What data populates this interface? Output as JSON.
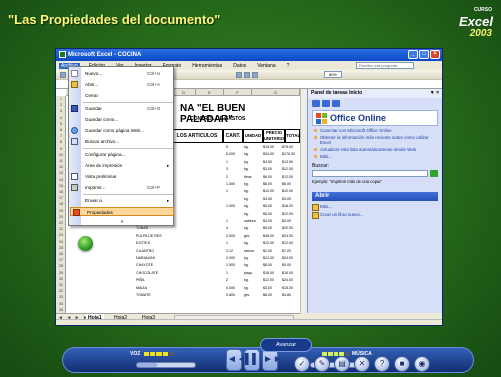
{
  "course": {
    "title": "\"Las Propiedades del documento\"",
    "logo_curso": "CURSO",
    "logo_excel": "Excel",
    "logo_year": "2003"
  },
  "window": {
    "title": "Microsoft Excel - COCINA",
    "btn_min": "_",
    "btn_max": "□",
    "btn_close": "×"
  },
  "menubar": {
    "items": [
      "Archivo",
      "Edición",
      "Ver",
      "Insertar",
      "Formato",
      "Herramientas",
      "Datos",
      "Ventana",
      "?"
    ],
    "help_placeholder": "Escriba una pregunta",
    "zoom": "80%"
  },
  "sheet": {
    "title": "NA \"EL BUEN PALADAR\"",
    "subtitle": "CONTROL DE GASTOS",
    "columns": [
      "A",
      "B",
      "C",
      "D",
      "E",
      "F",
      "G"
    ],
    "headers": {
      "articulos": "LOS ARTICULOS",
      "cant": "CANT.",
      "unidad": "UNIDAD",
      "precio": "PRECIO UNITARIO",
      "total": "TOTAL"
    },
    "row_numbers": [
      "1",
      "2",
      "3",
      "4",
      "5",
      "6",
      "7",
      "8",
      "9",
      "10",
      "11",
      "12",
      "13",
      "14",
      "15",
      "16",
      "17",
      "18",
      "19",
      "20",
      "21",
      "22",
      "23",
      "24",
      "25",
      "26",
      "27",
      "28",
      "29",
      "30",
      "31",
      "32",
      "33",
      "34",
      "35"
    ],
    "rows": [
      {
        "item": "",
        "cant": "5",
        "unidad": "kg.",
        "precio": "$15.00",
        "total": "$75.00"
      },
      {
        "item": "",
        "cant": "5.000",
        "unidad": "kg.",
        "precio": "$34.00",
        "total": "$170.00"
      },
      {
        "item": "",
        "cant": "1",
        "unidad": "kg.",
        "precio": "$4.50",
        "total": "$13.50"
      },
      {
        "item": "",
        "cant": "3",
        "unidad": "kg.",
        "precio": "$3.00",
        "total": "$12.00"
      },
      {
        "item": "",
        "cant": "2",
        "unidad": "litros",
        "precio": "$6.00",
        "total": "$12.00"
      },
      {
        "item": "",
        "cant": "1.000",
        "unidad": "kg.",
        "precio": "$6.00",
        "total": "$6.00"
      },
      {
        "item": "AMARRO",
        "cant": "1",
        "unidad": "kg.",
        "precio": "$10.00",
        "total": "$10.00"
      },
      {
        "item": "CEBOLLA",
        "cant": "",
        "unidad": "kg.",
        "precio": "$3.00",
        "total": "$3.00"
      },
      {
        "item": "ZANAHORIA",
        "cant": "1.000",
        "unidad": "kg.",
        "precio": "$5.00",
        "total": "$16.20"
      },
      {
        "item": "APIO/MATE",
        "cant": "",
        "unidad": "kg.",
        "precio": "$6.00",
        "total": "$12.00"
      },
      {
        "item": "AJOS",
        "cant": "1",
        "unidad": "cabeza",
        "precio": "$3.00",
        "total": "$3.00"
      },
      {
        "item": "TUNAS",
        "cant": "4",
        "unidad": "kg.",
        "precio": "$5.00",
        "total": "$20.00"
      },
      {
        "item": "PULPA DE RES",
        "cant": "0.500",
        "unidad": "grs.",
        "precio": "$48.00",
        "total": "$24.00"
      },
      {
        "item": "EJOTES",
        "cant": "1",
        "unidad": "kg.",
        "precio": "$12.00",
        "total": "$12.00"
      },
      {
        "item": "CILANTRO",
        "cant": "3.12",
        "unidad": "ramos",
        "precio": "$2.00",
        "total": "$7.20"
      },
      {
        "item": "NARANJAS",
        "cant": "2.000",
        "unidad": "kg.",
        "precio": "$12.00",
        "total": "$24.00"
      },
      {
        "item": "CHAYOTE",
        "cant": "1.500",
        "unidad": "kg.",
        "precio": "$6.00",
        "total": "$9.00"
      },
      {
        "item": "CHOCOLATE",
        "cant": "1",
        "unidad": "paqu.",
        "precio": "$16.00",
        "total": "$16.00"
      },
      {
        "item": "PIÑA",
        "cant": "2",
        "unidad": "kg.",
        "precio": "$12.00",
        "total": "$24.00"
      },
      {
        "item": "MAIZA",
        "cant": "5.000",
        "unidad": "kg.",
        "precio": "$3.00",
        "total": "$15.00"
      },
      {
        "item": "TOMATE",
        "cant": "0.800",
        "unidad": "grs.",
        "precio": "$8.00",
        "total": "$4.80"
      }
    ],
    "tabs": [
      "Hoja1",
      "Hoja2",
      "Hoja3"
    ],
    "tab_arrows": "◄ ◄ ► ►"
  },
  "file_menu": {
    "items": [
      {
        "label": "Nuevo...",
        "shortcut": "Ctrl+U"
      },
      {
        "label": "Abrir...",
        "shortcut": "Ctrl+A"
      },
      {
        "label": "Cerrar",
        "shortcut": ""
      },
      {
        "label": "Guardar",
        "shortcut": "Ctrl+G"
      },
      {
        "label": "Guardar como...",
        "shortcut": ""
      },
      {
        "label": "Guardar como página Web...",
        "shortcut": ""
      },
      {
        "label": "Buscar archivo...",
        "shortcut": ""
      },
      {
        "label": "Configurar página...",
        "shortcut": ""
      },
      {
        "label": "Área de impresión",
        "shortcut": ""
      },
      {
        "label": "Vista preliminar",
        "shortcut": ""
      },
      {
        "label": "Imprimir...",
        "shortcut": "Ctrl+P"
      },
      {
        "label": "Enviar a",
        "shortcut": ""
      },
      {
        "label": "Propiedades",
        "shortcut": ""
      }
    ],
    "expand": "»"
  },
  "task_pane": {
    "title": "Panel de tareas Inicio",
    "close": "▼ ×",
    "office_online": "Office Online",
    "links": [
      "Conectar con Microsoft Office Online",
      "Obtener la información más reciente sobre cómo utilizar Excel",
      "Actualizar esta lista automáticamente desde Web"
    ],
    "more": "Más...",
    "search_label": "Buscar:",
    "example": "Ejemplo: \"Imprimir más de una copia\"",
    "open_header": "Abrir",
    "open_more": "Más...",
    "new_book": "Crear un libro nuevo..."
  },
  "player": {
    "voz": "VOZ",
    "musica": "MÚSICA",
    "advance": "Avanzar",
    "progress": 0.35,
    "buttons": [
      "◄◄",
      "▌▌",
      "►►"
    ],
    "icons": [
      "check-icon",
      "notes-icon",
      "print-icon",
      "close-icon",
      "help-icon",
      "stop-icon"
    ]
  }
}
